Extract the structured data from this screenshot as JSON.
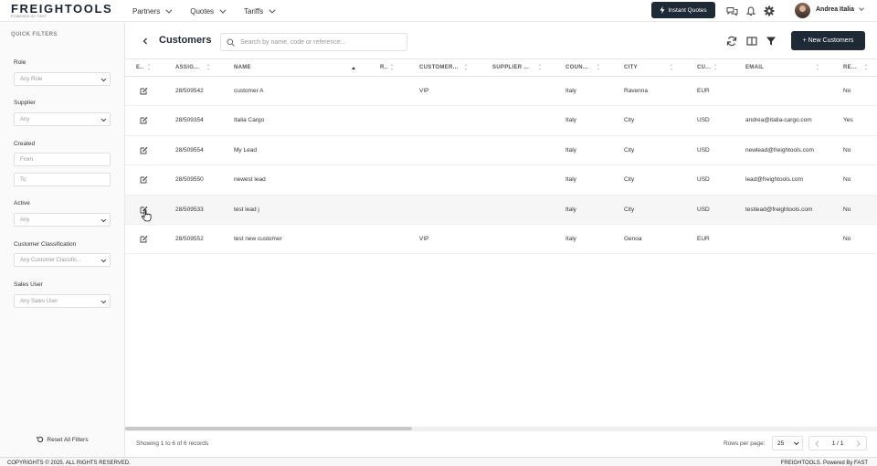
{
  "brand": {
    "name": "FREIGHTOOLS",
    "tagline": "POWERED BY FAST"
  },
  "nav": [
    {
      "label": "Partners"
    },
    {
      "label": "Quotes"
    },
    {
      "label": "Tariffs"
    }
  ],
  "header": {
    "instant_quotes": "Instant Quotes",
    "user_name": "Andrea Italia"
  },
  "sidebar": {
    "title": "QUICK FILTERS",
    "filters": {
      "role": {
        "label": "Role",
        "value": "Any Role"
      },
      "supplier": {
        "label": "Supplier",
        "value": "Any"
      },
      "created": {
        "label": "Created",
        "from": "From",
        "to": "To"
      },
      "active": {
        "label": "Active",
        "value": "Any"
      },
      "classification": {
        "label": "Customer Classification",
        "value": "Any Customer Classific..."
      },
      "sales_user": {
        "label": "Sales User",
        "value": "Any Sales User"
      }
    },
    "reset": "Reset All Filters"
  },
  "page": {
    "title": "Customers",
    "search_placeholder": "Search by name, code or reference...",
    "new_button": "+ New Customers"
  },
  "table": {
    "columns": [
      "E..",
      "ASSIG...",
      "NAME",
      "R..",
      "CUSTOMER...",
      "SUPPLIER ...",
      "COUN...",
      "CITY",
      "CU...",
      "EMAIL",
      "RE..."
    ],
    "rows": [
      {
        "assigned": "28/509542",
        "name": "customer A",
        "classification": "VIP",
        "country": "Italy",
        "city": "Ravenna",
        "currency": "EUR",
        "email": "",
        "re": "No"
      },
      {
        "assigned": "28/509354",
        "name": "Italia Cargo",
        "classification": "",
        "country": "Italy",
        "city": "City",
        "currency": "USD",
        "email": "andrea@italia-cargo.com",
        "re": "Yes"
      },
      {
        "assigned": "28/509554",
        "name": "My Lead",
        "classification": "",
        "country": "Italy",
        "city": "City",
        "currency": "USD",
        "email": "newlead@freightools.com",
        "re": "No"
      },
      {
        "assigned": "28/509550",
        "name": "newest lead",
        "classification": "",
        "country": "Italy",
        "city": "City",
        "currency": "USD",
        "email": "lead@freightools.com",
        "re": "No"
      },
      {
        "assigned": "28/509533",
        "name": "test lead j",
        "classification": "",
        "country": "Italy",
        "city": "City",
        "currency": "USD",
        "email": "testlead@freightools.com",
        "re": "No"
      },
      {
        "assigned": "28/509552",
        "name": "test new customer",
        "classification": "VIP",
        "country": "Italy",
        "city": "Genoa",
        "currency": "EUR",
        "email": "",
        "re": "No"
      }
    ]
  },
  "pager": {
    "showing": "Showing 1 to 6 of 6 records",
    "rows_per_page_label": "Rows per page:",
    "rows_per_page": "25",
    "page": "1 / 1"
  },
  "footer": {
    "copyright": "COPYRIGHTS © 2025. ALL RIGHTS RESERVED.",
    "powered": "FREIGHTOOLS. Powered By FAST"
  },
  "colors": {
    "primary": "#1f2a37",
    "hover_row": "#f6f6f6"
  }
}
